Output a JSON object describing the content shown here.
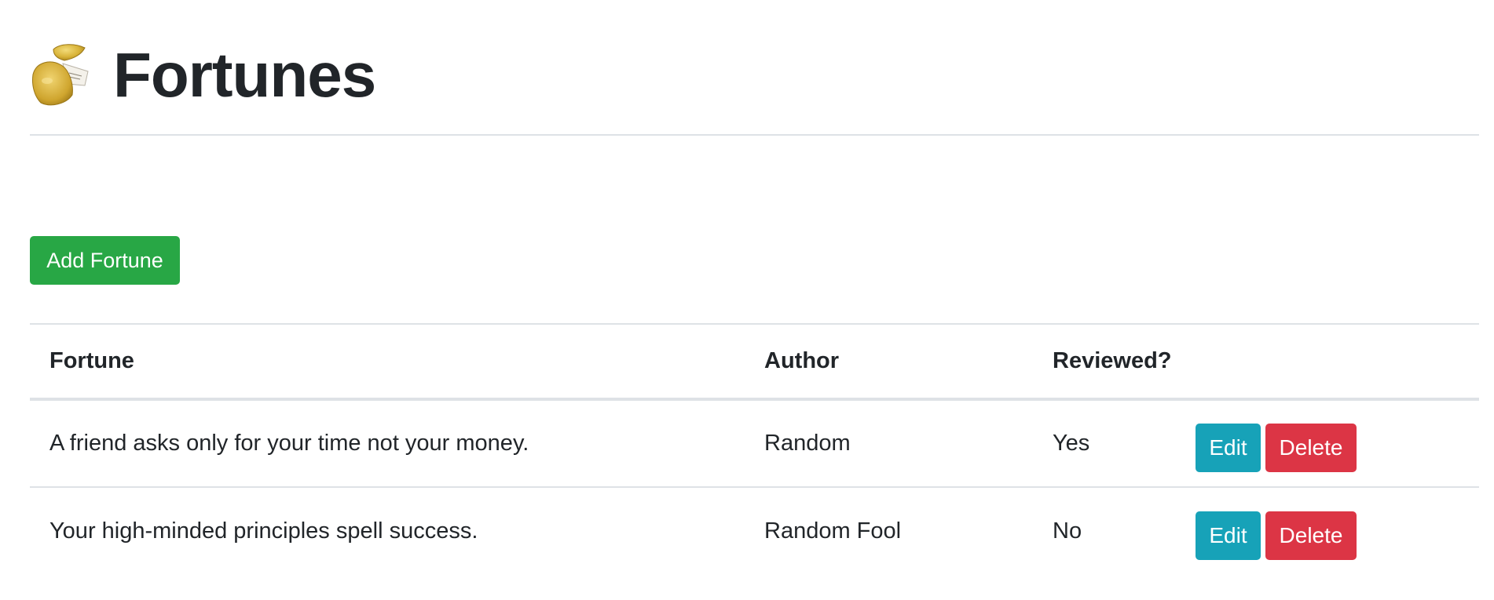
{
  "header": {
    "title": "Fortunes",
    "icon": "fortune-cookie-icon"
  },
  "toolbar": {
    "add_label": "Add Fortune"
  },
  "colors": {
    "add_button": "#28a745",
    "edit_button": "#17a2b8",
    "delete_button": "#dc3545"
  },
  "table": {
    "columns": [
      "Fortune",
      "Author",
      "Reviewed?",
      ""
    ],
    "rows": [
      {
        "fortune": "A friend asks only for your time not your money.",
        "author": "Random",
        "reviewed": "Yes",
        "edit_label": "Edit",
        "delete_label": "Delete"
      },
      {
        "fortune": "Your high-minded principles spell success.",
        "author": "Random Fool",
        "reviewed": "No",
        "edit_label": "Edit",
        "delete_label": "Delete"
      }
    ]
  }
}
